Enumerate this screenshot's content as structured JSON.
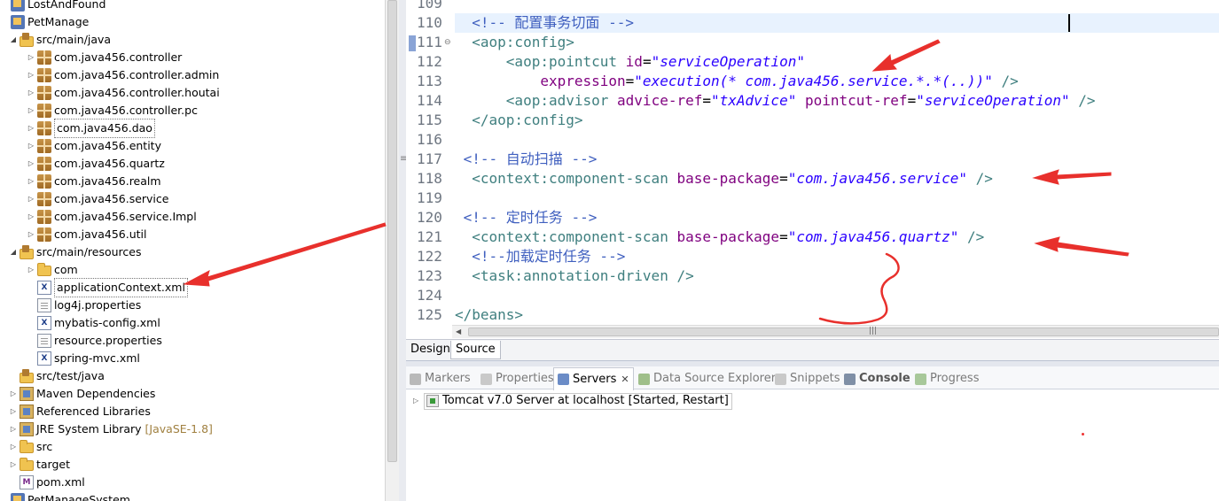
{
  "tree": {
    "items": [
      {
        "label": "LostAndFound",
        "icon": "project-icon",
        "twisty": "",
        "level": 0
      },
      {
        "label": "PetManage",
        "icon": "project-icon",
        "twisty": "",
        "level": 0
      },
      {
        "label": "src/main/java",
        "icon": "source-folder-icon",
        "twisty": "expanded",
        "level": 1
      },
      {
        "label": "com.java456.controller",
        "icon": "package-icon",
        "twisty": "collapsed",
        "level": 2
      },
      {
        "label": "com.java456.controller.admin",
        "icon": "package-icon",
        "twisty": "collapsed",
        "level": 2
      },
      {
        "label": "com.java456.controller.houtai",
        "icon": "package-icon",
        "twisty": "collapsed",
        "level": 2
      },
      {
        "label": "com.java456.controller.pc",
        "icon": "package-icon",
        "twisty": "collapsed",
        "level": 2
      },
      {
        "label": "com.java456.dao",
        "icon": "package-icon",
        "twisty": "collapsed",
        "level": 2,
        "selected": true
      },
      {
        "label": "com.java456.entity",
        "icon": "package-icon",
        "twisty": "collapsed",
        "level": 2
      },
      {
        "label": "com.java456.quartz",
        "icon": "package-icon",
        "twisty": "collapsed",
        "level": 2
      },
      {
        "label": "com.java456.realm",
        "icon": "package-icon",
        "twisty": "collapsed",
        "level": 2
      },
      {
        "label": "com.java456.service",
        "icon": "package-icon",
        "twisty": "collapsed",
        "level": 2
      },
      {
        "label": "com.java456.service.Impl",
        "icon": "package-icon",
        "twisty": "collapsed",
        "level": 2
      },
      {
        "label": "com.java456.util",
        "icon": "package-icon",
        "twisty": "collapsed",
        "level": 2
      },
      {
        "label": "src/main/resources",
        "icon": "source-folder-icon",
        "twisty": "expanded",
        "level": 1
      },
      {
        "label": "com",
        "icon": "folder-icon",
        "twisty": "collapsed",
        "level": 2
      },
      {
        "label": "applicationContext.xml",
        "icon": "xml-file-icon",
        "twisty": "",
        "level": 2,
        "selected": true
      },
      {
        "label": "log4j.properties",
        "icon": "properties-file-icon",
        "twisty": "",
        "level": 2
      },
      {
        "label": "mybatis-config.xml",
        "icon": "xml-file-icon",
        "twisty": "",
        "level": 2
      },
      {
        "label": "resource.properties",
        "icon": "properties-file-icon",
        "twisty": "",
        "level": 2
      },
      {
        "label": "spring-mvc.xml",
        "icon": "xml-file-icon",
        "twisty": "",
        "level": 2
      },
      {
        "label": "src/test/java",
        "icon": "source-folder-icon",
        "twisty": "",
        "level": 1
      },
      {
        "label": "Maven Dependencies",
        "icon": "library-icon",
        "twisty": "collapsed",
        "level": 1
      },
      {
        "label": "Referenced Libraries",
        "icon": "library-icon",
        "twisty": "collapsed",
        "level": 1
      },
      {
        "label": "JRE System Library",
        "icon": "library-icon",
        "twisty": "collapsed",
        "level": 1,
        "decoration": "[JavaSE-1.8]"
      },
      {
        "label": "src",
        "icon": "folder-icon",
        "twisty": "collapsed",
        "level": 1
      },
      {
        "label": "target",
        "icon": "folder-icon",
        "twisty": "collapsed",
        "level": 1
      },
      {
        "label": "pom.xml",
        "icon": "pom-file-icon",
        "twisty": "",
        "level": 1
      },
      {
        "label": "PetManageSystem",
        "icon": "project-icon",
        "twisty": "",
        "level": 0
      }
    ]
  },
  "editor": {
    "lines": [
      {
        "num": "109",
        "html": ""
      },
      {
        "num": "110",
        "html": "  <span class=\"cm\">&lt;!-- 配置事务切面 --&gt;</span>"
      },
      {
        "num": "111",
        "html": "  <span class=\"tag\">&lt;aop:config&gt;</span>"
      },
      {
        "num": "112",
        "html": "      <span class=\"tag\">&lt;aop:pointcut</span> <span class=\"at\">id</span>=<span class=\"av\">\"serviceOperation\"</span>"
      },
      {
        "num": "113",
        "html": "          <span class=\"at\">expression</span>=<span class=\"av\">\"execution(* com.java456.service.*.*(..))\"</span> <span class=\"tag\">/&gt;</span>"
      },
      {
        "num": "114",
        "html": "      <span class=\"tag\">&lt;aop:advisor</span> <span class=\"at\">advice-ref</span>=<span class=\"av\">\"txAdvice\"</span> <span class=\"at\">pointcut-ref</span>=<span class=\"av\">\"serviceOperation\"</span> <span class=\"tag\">/&gt;</span>"
      },
      {
        "num": "115",
        "html": "  <span class=\"tag\">&lt;/aop:config&gt;</span>"
      },
      {
        "num": "116",
        "html": ""
      },
      {
        "num": "117",
        "html": " <span class=\"cm\">&lt;!-- 自动扫描 --&gt;</span>"
      },
      {
        "num": "118",
        "html": "  <span class=\"tag\">&lt;context:component-scan</span> <span class=\"at\">base-package</span>=<span class=\"av\">\"com.java456.service\"</span> <span class=\"tag\">/&gt;</span>"
      },
      {
        "num": "119",
        "html": ""
      },
      {
        "num": "120",
        "html": " <span class=\"cm\">&lt;!-- 定时任务 --&gt;</span>"
      },
      {
        "num": "121",
        "html": "  <span class=\"tag\">&lt;context:component-scan</span> <span class=\"at\">base-package</span>=<span class=\"av\">\"com.java456.quartz\"</span> <span class=\"tag\">/&gt;</span>"
      },
      {
        "num": "122",
        "html": "  <span class=\"cm\">&lt;!--加载定时任务 --&gt;</span>"
      },
      {
        "num": "123",
        "html": "  <span class=\"tag\">&lt;task:annotation-driven</span> <span class=\"tag\">/&gt;</span>"
      },
      {
        "num": "124",
        "html": ""
      },
      {
        "num": "125",
        "html": "<span class=\"tag\">&lt;/beans&gt;</span>"
      }
    ],
    "tabs": {
      "design": "Design",
      "source": "Source"
    }
  },
  "views": {
    "tabs": [
      {
        "label": "Markers",
        "icon": "markers-icon",
        "color": "#b9b9b9"
      },
      {
        "label": "Properties",
        "icon": "properties-icon",
        "color": "#c9c9c9"
      },
      {
        "label": "Servers",
        "icon": "servers-icon",
        "color": "#6b8cc7",
        "active": true,
        "close": "✕"
      },
      {
        "label": "Data Source Explorer",
        "icon": "data-source-icon",
        "color": "#9fbf8a"
      },
      {
        "label": "Snippets",
        "icon": "snippets-icon",
        "color": "#c9c9c9"
      },
      {
        "label": "Console",
        "icon": "console-icon",
        "color": "#7f8fa6",
        "bold": true
      },
      {
        "label": "Progress",
        "icon": "progress-icon",
        "color": "#a8c89a"
      }
    ],
    "server": {
      "label": "Tomcat v7.0 Server at localhost  [Started, Restart]"
    }
  },
  "colors": {
    "annotation_red": "#e8302c",
    "tag": "#3f7f7f",
    "attr": "#7f007f",
    "value": "#2a00ff",
    "comment": "#3f5fbf"
  }
}
